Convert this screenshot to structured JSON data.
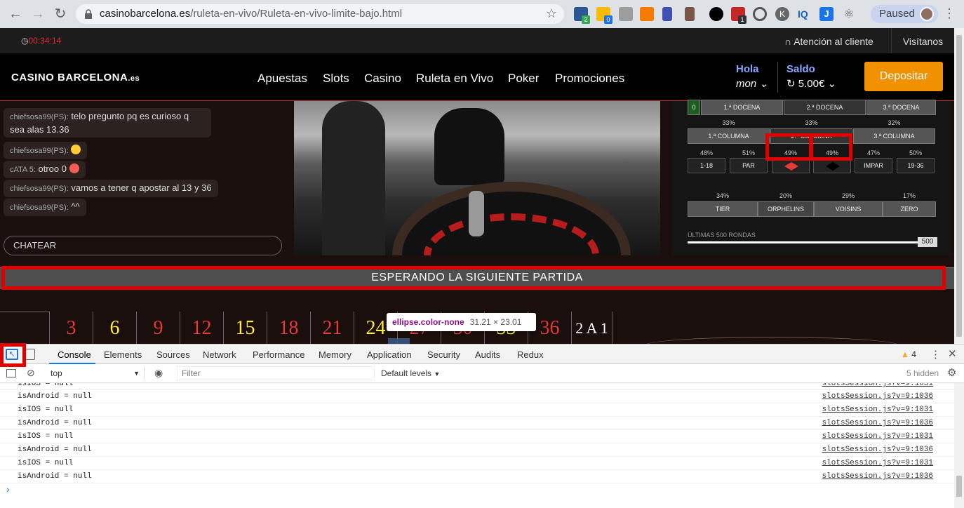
{
  "browser": {
    "url_domain": "casinobarcelona.es",
    "url_path": "/ruleta-en-vivo/Ruleta-en-vivo-limite-bajo.html",
    "profile_label": "Paused",
    "ext_badges": [
      "2",
      "0",
      "1"
    ]
  },
  "site": {
    "timer": "00:34:14",
    "support_label": "Atención al cliente",
    "visit_label": "Visítanos",
    "logo_main": "CASINO BARCELONA",
    "logo_suffix": ".es",
    "nav": [
      "Apuestas",
      "Slots",
      "Casino",
      "Ruleta en Vivo",
      "Poker",
      "Promociones"
    ],
    "greeting": "Hola",
    "username": "mon",
    "balance_label": "Saldo",
    "balance_value": "5.00€",
    "deposit_label": "Depositar"
  },
  "chat": {
    "messages": [
      {
        "user": "chiefsosa99(PS):",
        "text": "telo pregunto pq es curioso q sea alas 13.36"
      },
      {
        "user": "chiefsosa99(PS):",
        "text": ""
      },
      {
        "user": "cATA 5:",
        "text": "otroo 0"
      },
      {
        "user": "chiefsosa99(PS):",
        "text": "vamos a tener q apostar al 13 y 36"
      },
      {
        "user": "chiefsosa99(PS):",
        "text": "^^"
      }
    ],
    "input_label": "CHATEAR"
  },
  "stats": {
    "zero_cell": "0",
    "docenas": [
      "1.ª DOCENA",
      "2.ª DOCENA",
      "3.ª DOCENA"
    ],
    "columna_pcts": [
      "33%",
      "33%",
      "32%"
    ],
    "columnas": [
      "1.ª COLUMNA",
      "2.ª COLUMNA",
      "3.ª COLUMNA"
    ],
    "even_pcts": [
      "48%",
      "51%",
      "49%",
      "49%",
      "47%",
      "50%"
    ],
    "even_labels": [
      "1-18",
      "PAR",
      "",
      "",
      "IMPAR",
      "19-36"
    ],
    "sector_pcts": [
      "34%",
      "20%",
      "29%",
      "17%"
    ],
    "sectors": [
      "TIER",
      "ORPHELINS",
      "VOISINS",
      "ZERO"
    ],
    "rounds_label": "ÚLTIMAS 500 RONDAS",
    "rounds_value": "500"
  },
  "waiting_text": "ESPERANDO LA SIGUIENTE PARTIDA",
  "table_numbers": [
    {
      "n": "3",
      "c": "#e53935"
    },
    {
      "n": "6",
      "c": "#ffeb3b"
    },
    {
      "n": "9",
      "c": "#e53935"
    },
    {
      "n": "12",
      "c": "#e53935"
    },
    {
      "n": "15",
      "c": "#ffeb3b"
    },
    {
      "n": "18",
      "c": "#e53935"
    },
    {
      "n": "21",
      "c": "#e53935"
    },
    {
      "n": "24",
      "c": "#ffeb3b"
    },
    {
      "n": "27",
      "c": "#e53935"
    },
    {
      "n": "30",
      "c": "#e53935"
    },
    {
      "n": "33",
      "c": "#ffeb3b"
    },
    {
      "n": "36",
      "c": "#e53935"
    }
  ],
  "table_end_label": "2 A 1",
  "tooltip": {
    "selector": "ellipse.color-none",
    "dims": "31.21 × 23.01"
  },
  "devtools": {
    "tabs": [
      "Console",
      "Elements",
      "Sources",
      "Network",
      "Performance",
      "Memory",
      "Application",
      "Security",
      "Audits",
      "Redux"
    ],
    "warnings": "4",
    "context": "top",
    "filter_placeholder": "Filter",
    "levels": "Default levels",
    "hidden": "5 hidden",
    "logs": [
      {
        "text": "isAndroid = null",
        "src": "slotsSession.js?v=9:1036"
      },
      {
        "text": "isIOS = null",
        "src": "slotsSession.js?v=9:1031"
      },
      {
        "text": "isAndroid = null",
        "src": "slotsSession.js?v=9:1036"
      },
      {
        "text": "isIOS = null",
        "src": "slotsSession.js?v=9:1031"
      },
      {
        "text": "isAndroid = null",
        "src": "slotsSession.js?v=9:1036"
      },
      {
        "text": "isIOS = null",
        "src": "slotsSession.js?v=9:1031"
      },
      {
        "text": "isAndroid = null",
        "src": "slotsSession.js?v=9:1036"
      }
    ],
    "prompt": "›"
  }
}
